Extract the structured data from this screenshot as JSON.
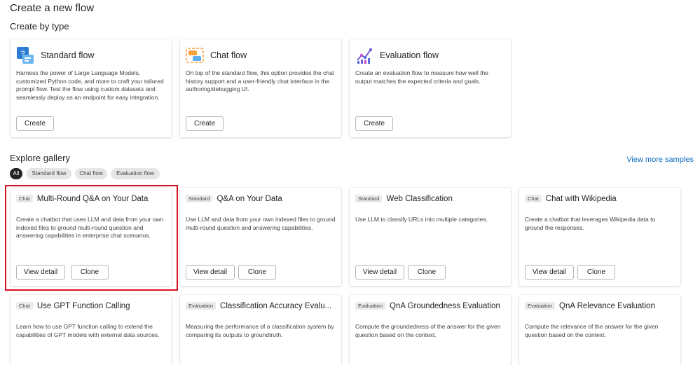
{
  "page": {
    "title": "Create a new flow",
    "create_by_type": "Create by type",
    "explore_gallery": "Explore gallery",
    "view_more": "View more samples"
  },
  "types": [
    {
      "icon": "standard-flow-icon",
      "title": "Standard flow",
      "desc": "Harness the power of Large Language Models, customized Python code, and more to craft your tailored prompt flow. Test the flow using custom datasets and seamlessly deploy as an endpoint for easy integration.",
      "button": "Create"
    },
    {
      "icon": "chat-flow-icon",
      "title": "Chat flow",
      "desc": "On top of the standard flow, this option provides the chat history support and a user-friendly chat interface in the authoring/debugging UI.",
      "button": "Create"
    },
    {
      "icon": "evaluation-flow-icon",
      "title": "Evaluation flow",
      "desc": "Create an evaluation flow to measure how well the output matches the expected criteria and goals.",
      "button": "Create"
    }
  ],
  "filters": [
    "All",
    "Standard flow",
    "Chat flow",
    "Evaluation flow"
  ],
  "gallery": [
    {
      "tag": "Chat",
      "title": "Multi-Round Q&A on Your Data",
      "desc": "Create a chatbot that uses LLM and data from your own indexed files to ground multi-round question and answering capabilities in enterprise chat scenarios.",
      "view": "View detail",
      "clone": "Clone"
    },
    {
      "tag": "Standard",
      "title": "Q&A on Your Data",
      "desc": "Use LLM and data from your own indexed files to ground multi-round question and answering capabilities.",
      "view": "View detail",
      "clone": "Clone"
    },
    {
      "tag": "Standard",
      "title": "Web Classification",
      "desc": "Use LLM to classify URLs into multiple categories.",
      "view": "View detail",
      "clone": "Clone"
    },
    {
      "tag": "Chat",
      "title": "Chat with Wikipedia",
      "desc": "Create a chatbot that leverages Wikipedia data to ground the responses.",
      "view": "View detail",
      "clone": "Clone"
    },
    {
      "tag": "Chat",
      "title": "Use GPT Function Calling",
      "desc": "Learn how to use GPT function calling to extend the capabilities of GPT models with external data sources."
    },
    {
      "tag": "Evaluation",
      "title": "Classification Accuracy Evalu...",
      "desc": "Measuring the performance of a classification system by comparing its outputs to groundtruth."
    },
    {
      "tag": "Evaluation",
      "title": "QnA Groundedness Evaluation",
      "desc": "Compute the groundedness of the answer for the given question based on the context."
    },
    {
      "tag": "Evaluation",
      "title": "QnA Relevance Evaluation",
      "desc": "Compute the relevance of the answer for the given question based on the context."
    }
  ],
  "colors": {
    "accent": "#0f6cbd",
    "highlight": "#d6121e"
  }
}
